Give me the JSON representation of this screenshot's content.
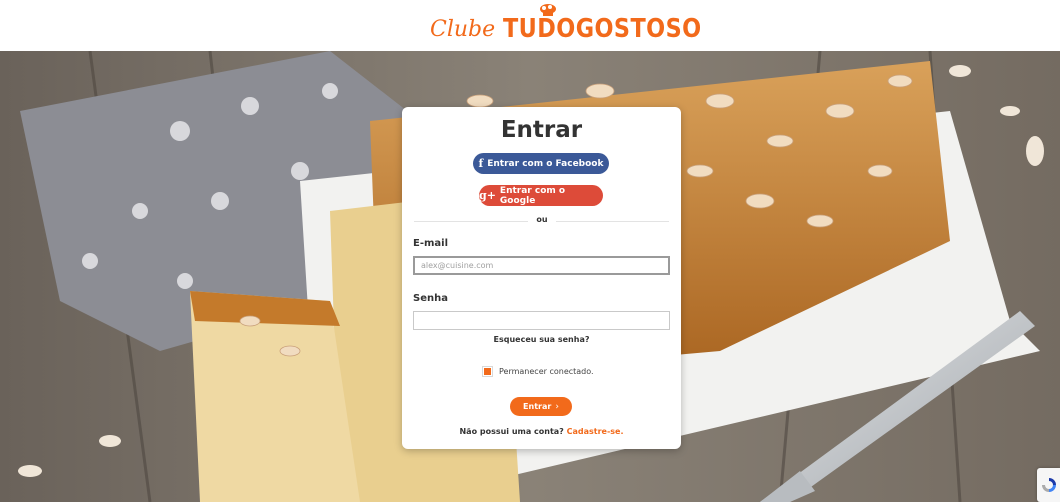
{
  "header": {
    "logo_script": "Clube",
    "logo_brand": "TUDOGOSTOSO"
  },
  "login": {
    "title": "Entrar",
    "facebook_label": "Entrar com o Facebook",
    "google_label": "Entrar com o Google",
    "divider_text": "ou",
    "email_label": "E-mail",
    "email_placeholder": "alex@cuisine.com",
    "email_value": "",
    "password_label": "Senha",
    "password_value": "",
    "forgot_label": "Esqueceu sua senha?",
    "remember_label": "Permanecer conectado.",
    "remember_checked": true,
    "submit_label": "Entrar",
    "no_account_text": "Não possui uma conta?",
    "signup_link": "Cadastre-se."
  },
  "icons": {
    "facebook": "f",
    "google_plus": "g+",
    "submit_chevron": "›"
  },
  "colors": {
    "brand_orange": "#f26a1b",
    "facebook_blue": "#3b5998",
    "google_red": "#dd4b39",
    "text_dark": "#333333"
  }
}
